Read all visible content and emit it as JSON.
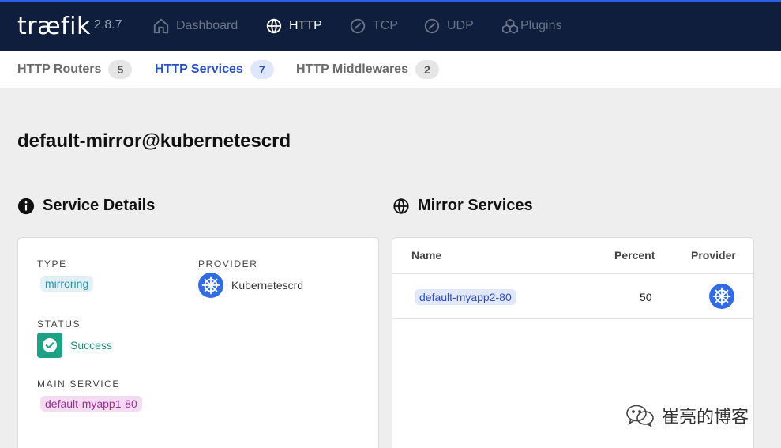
{
  "app": {
    "logo": "træfik",
    "version": "2.8.7"
  },
  "nav": [
    {
      "label": "Dashboard",
      "icon": "home-icon"
    },
    {
      "label": "HTTP",
      "icon": "globe-icon",
      "active": true
    },
    {
      "label": "TCP",
      "icon": "tcp-icon"
    },
    {
      "label": "UDP",
      "icon": "udp-icon"
    },
    {
      "label": "Plugins",
      "icon": "plugins-icon"
    }
  ],
  "subtabs": [
    {
      "label": "HTTP Routers",
      "count": "5"
    },
    {
      "label": "HTTP Services",
      "count": "7",
      "active": true
    },
    {
      "label": "HTTP Middlewares",
      "count": "2"
    }
  ],
  "page_title": "default-mirror@kubernetescrd",
  "details": {
    "title": "Service Details",
    "type_label": "TYPE",
    "type_value": "mirroring",
    "provider_label": "PROVIDER",
    "provider_value": "Kubernetescrd",
    "status_label": "STATUS",
    "status_value": "Success",
    "main_label": "MAIN SERVICE",
    "main_value": "default-myapp1-80"
  },
  "mirror": {
    "title": "Mirror Services",
    "columns": [
      "Name",
      "Percent",
      "Provider"
    ],
    "rows": [
      {
        "name": "default-myapp2-80",
        "percent": "50"
      }
    ]
  },
  "watermark": "崔亮的博客",
  "colors": {
    "nav_bg": "#0f1e3d",
    "accent": "#2a4fbf",
    "success": "#1ea285",
    "k8s": "#326ce5"
  }
}
